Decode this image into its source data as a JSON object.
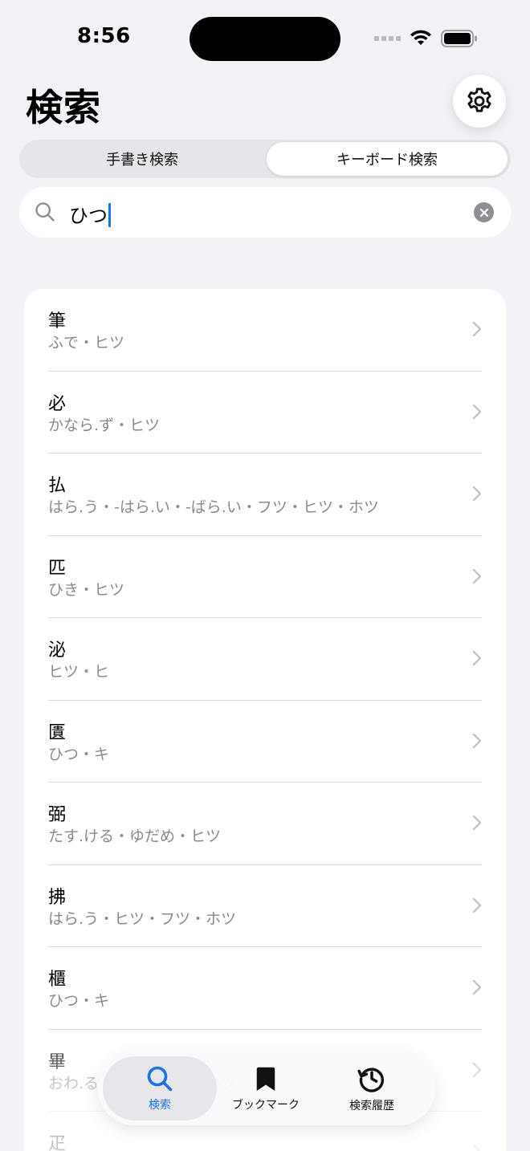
{
  "status_bar": {
    "time": "8:56"
  },
  "header": {
    "title": "検索"
  },
  "segmented": {
    "left_label": "手書き検索",
    "right_label": "キーボード検索",
    "selected": "right"
  },
  "search": {
    "value": "ひつ"
  },
  "results": [
    {
      "kanji": "筆",
      "reading": "ふで・ヒツ"
    },
    {
      "kanji": "必",
      "reading": "かなら.ず・ヒツ"
    },
    {
      "kanji": "払",
      "reading": "はら.う・-はら.い・-ばら.い・フツ・ヒツ・ホツ"
    },
    {
      "kanji": "匹",
      "reading": "ひき・ヒツ"
    },
    {
      "kanji": "泌",
      "reading": "ヒツ・ヒ"
    },
    {
      "kanji": "匱",
      "reading": "ひつ・キ"
    },
    {
      "kanji": "弼",
      "reading": "たす.ける・ゆだめ・ヒツ"
    },
    {
      "kanji": "拂",
      "reading": "はら.う・ヒツ・フツ・ホツ"
    },
    {
      "kanji": "櫃",
      "reading": "ひつ・キ"
    },
    {
      "kanji": "畢",
      "reading": "おわ.る・ことごとく・ヒツ"
    },
    {
      "kanji": "疋",
      "reading": ""
    }
  ],
  "tabbar": {
    "tabs": [
      {
        "label": "検索",
        "icon": "search-icon",
        "active": true
      },
      {
        "label": "ブックマーク",
        "icon": "bookmark-icon",
        "active": false
      },
      {
        "label": "検索履歴",
        "icon": "history-icon",
        "active": false
      }
    ]
  },
  "colors": {
    "accent": "#1a73e8",
    "background": "#f2f2f7",
    "secondary_text": "#8a8a8e"
  }
}
